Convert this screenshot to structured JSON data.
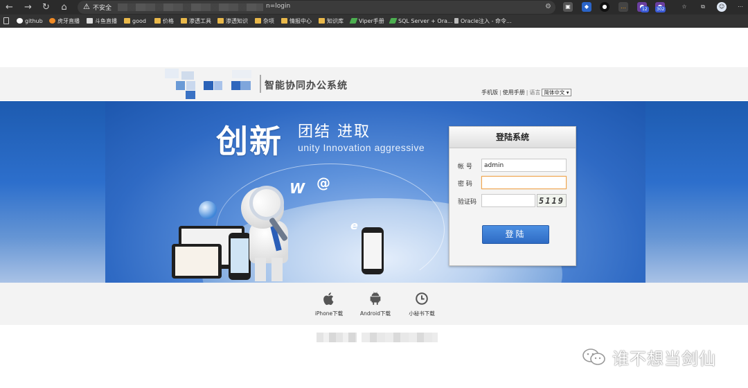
{
  "browser": {
    "security_label": "不安全",
    "url_visible": "n=login"
  },
  "bookmarks": [
    {
      "label": "github",
      "icon": "github-icon"
    },
    {
      "label": "虎牙直播",
      "icon": "huya-icon"
    },
    {
      "label": "斗鱼直播",
      "icon": "douyu-icon"
    },
    {
      "label": "good",
      "icon": "folder-icon"
    },
    {
      "label": "价格",
      "icon": "folder-icon"
    },
    {
      "label": "渗透工具",
      "icon": "folder-icon"
    },
    {
      "label": "渗透知识",
      "icon": "folder-icon"
    },
    {
      "label": "杂项",
      "icon": "folder-icon"
    },
    {
      "label": "情报中心",
      "icon": "folder-icon"
    },
    {
      "label": "知识库",
      "icon": "folder-icon"
    },
    {
      "label": "Viper手册",
      "icon": "viper-icon"
    },
    {
      "label": "SQL Server + Ora...",
      "icon": "viper-icon"
    },
    {
      "label": "Oracle注入 - 命令...",
      "icon": "page-icon"
    }
  ],
  "extensions": {
    "badge_1": "12",
    "badge_2": "302"
  },
  "header": {
    "system_name": "智能协同办公系统",
    "link_mobile": "手机版",
    "link_manual": "使用手册",
    "lang_label": "语言",
    "lang_selected": "简体中文"
  },
  "banner": {
    "slogan_main": "创新",
    "slogan_sub": "团结 进取",
    "slogan_en": "unity Innovation aggressive"
  },
  "login": {
    "title": "登陆系统",
    "account_label": "帐  号",
    "account_value": "admin",
    "password_label": "密  码",
    "password_value": "",
    "captcha_label": "验证码",
    "captcha_value": "",
    "captcha_text": "5119",
    "submit_label": "登陆"
  },
  "downloads": [
    {
      "label": "iPhone下载",
      "icon": "apple-icon"
    },
    {
      "label": "Android下载",
      "icon": "android-icon"
    },
    {
      "label": "小秘书下载",
      "icon": "clock-icon"
    }
  ],
  "watermark": "谁不想当剑仙"
}
